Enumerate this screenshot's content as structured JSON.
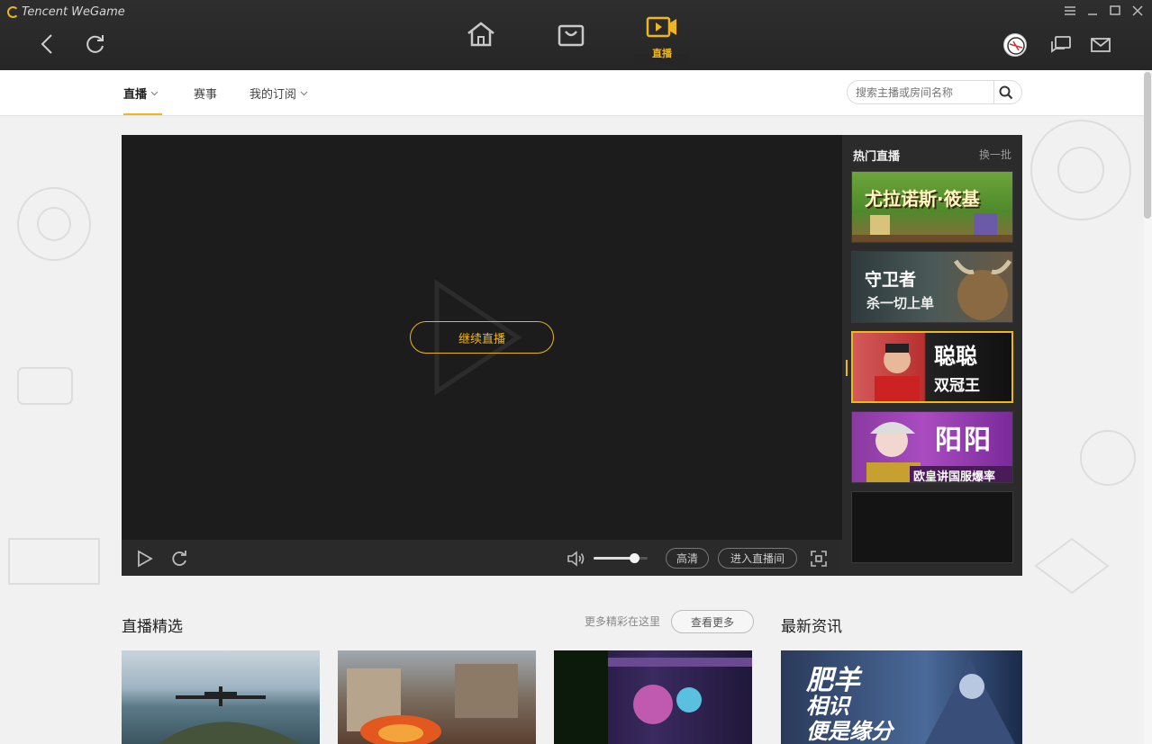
{
  "app": {
    "logo_text": "Tencent WeGame"
  },
  "topnav": {
    "live_tab_label": "直播"
  },
  "subnav": {
    "items": [
      {
        "label": "直播"
      },
      {
        "label": "赛事"
      },
      {
        "label": "我的订阅"
      }
    ],
    "search_placeholder": "搜索主播或房间名称"
  },
  "player": {
    "continue_label": "继续直播",
    "quality_label": "高清",
    "enter_room_label": "进入直播间",
    "volume_level": 0.75
  },
  "hot_live": {
    "title": "热门直播",
    "refresh_label": "换一批",
    "items": [
      {
        "line1": "尤拉诺斯·筱基",
        "line2": ""
      },
      {
        "line1": "守卫者",
        "line2": "杀一切上单"
      },
      {
        "line1": "聪聪",
        "line2": "双冠王"
      },
      {
        "line1": "阳阳",
        "line2": "欧皇讲国服爆率"
      },
      {
        "line1": "",
        "line2": ""
      }
    ]
  },
  "featured": {
    "title": "直播精选",
    "more_text": "更多精彩在这里",
    "more_button": "查看更多"
  },
  "news": {
    "title": "最新资讯",
    "card_text_1": "肥羊",
    "card_text_2": "相识",
    "card_text_3": "便是缘分"
  },
  "colors": {
    "accent": "#f0b61e",
    "topbar": "#2b2b2b",
    "player_bg": "#1c1c1c"
  }
}
